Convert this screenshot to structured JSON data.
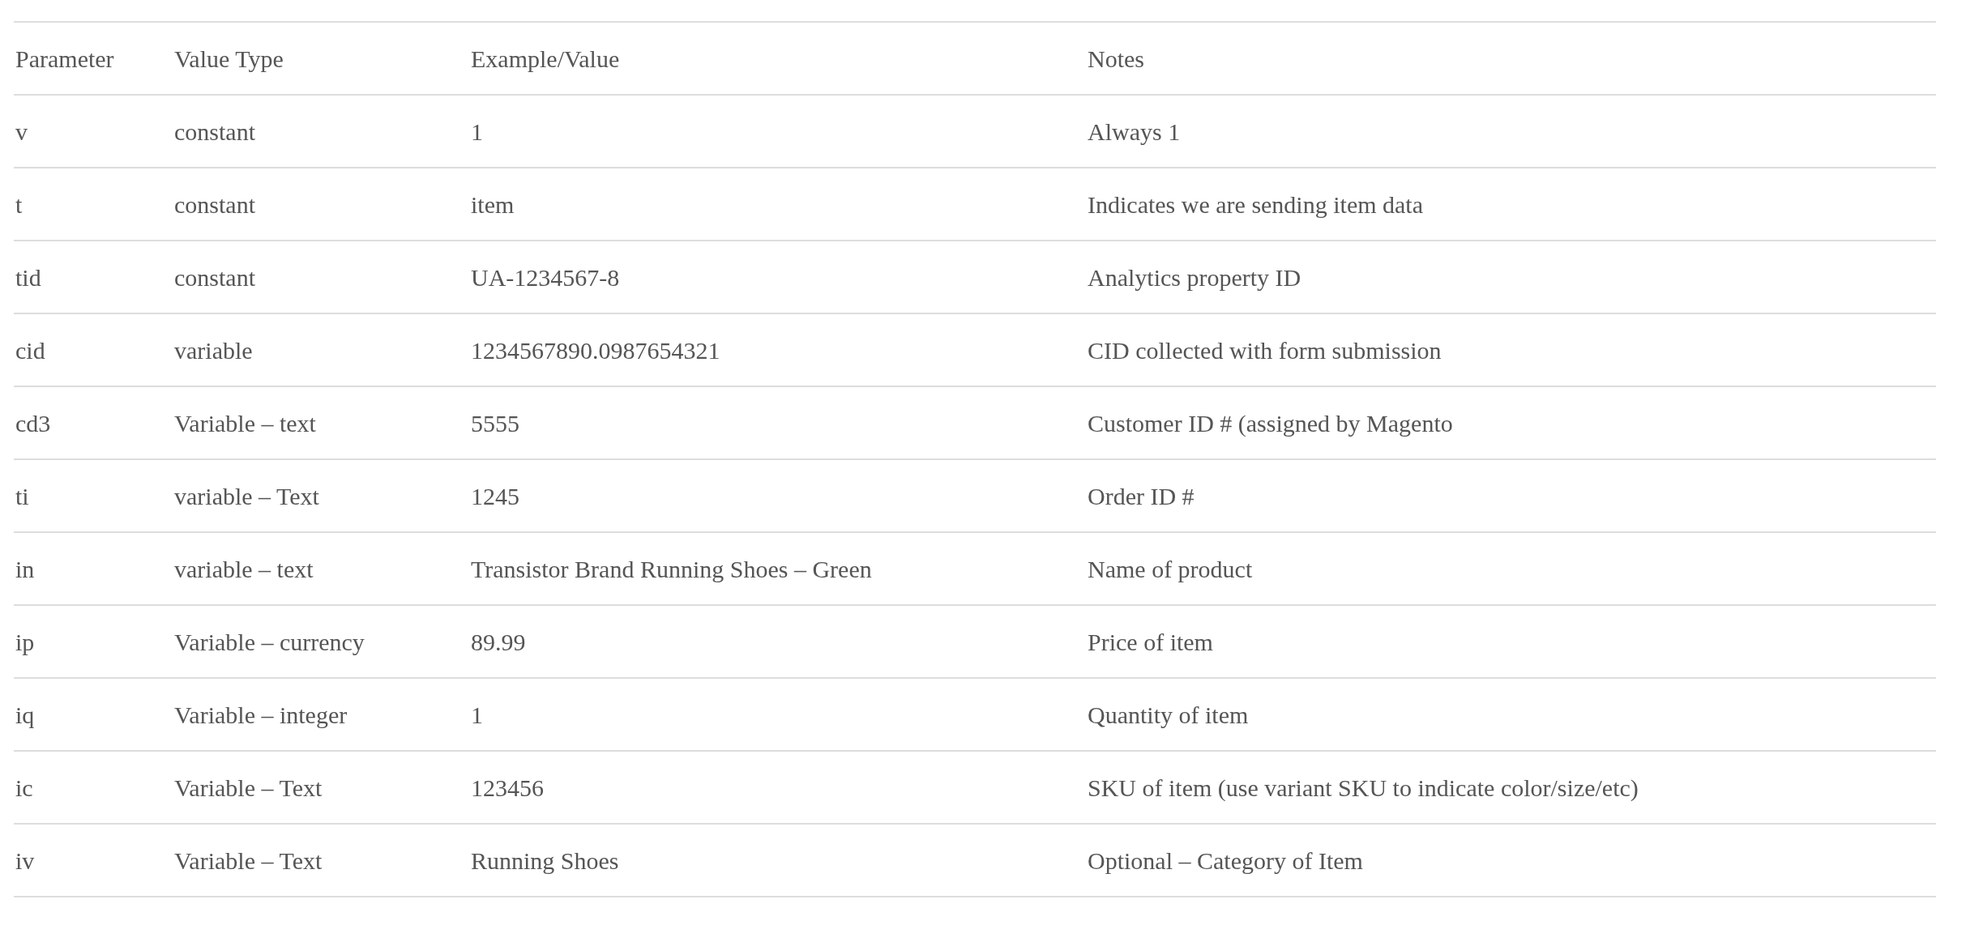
{
  "table": {
    "columns": [
      "Parameter",
      "Value Type",
      "Example/Value",
      "Notes"
    ],
    "rows": [
      [
        "v",
        "constant",
        "1",
        "Always 1"
      ],
      [
        "t",
        "constant",
        "item",
        "Indicates we are sending item data"
      ],
      [
        "tid",
        "constant",
        "UA-1234567-8",
        "Analytics property ID"
      ],
      [
        "cid",
        "variable",
        "1234567890.0987654321",
        "CID collected with form submission"
      ],
      [
        "cd3",
        "Variable – text",
        "5555",
        "Customer ID # (assigned by Magento"
      ],
      [
        "ti",
        "variable – Text",
        "1245",
        "Order ID #"
      ],
      [
        "in",
        "variable – text",
        "Transistor Brand Running Shoes – Green",
        "Name of product"
      ],
      [
        "ip",
        "Variable – currency",
        "89.99",
        "Price of item"
      ],
      [
        "iq",
        "Variable – integer",
        "1",
        "Quantity of item"
      ],
      [
        "ic",
        "Variable – Text",
        "123456",
        "SKU of item (use variant SKU to indicate color/size/etc)"
      ],
      [
        "iv",
        "Variable – Text",
        "Running Shoes",
        "Optional – Category of Item"
      ]
    ]
  }
}
